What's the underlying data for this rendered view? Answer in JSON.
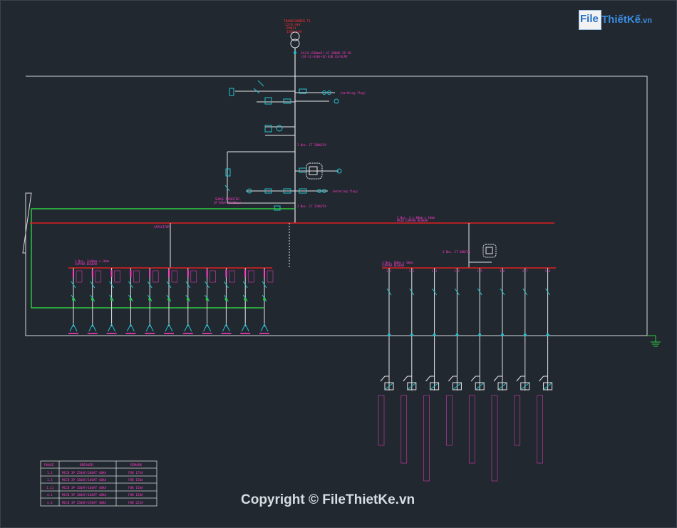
{
  "diagram": {
    "transformer_label": [
      "TRANSFORMER T1",
      "22/0.4kV",
      "DYN11",
      "1500 kVA"
    ],
    "main_cable_label": [
      "3X(1C-630mm2) 4C 2000A 3P 50",
      "(3X-1C-630)+1C-630 CU/XLPE"
    ],
    "earthing_label": "(earthing flag)",
    "metering_label": "(metering flag)",
    "ct_label_1": "3 Nos. CT 2000/5A",
    "ct_label_2": "3 Nos. CT 2500/5A",
    "surge_label": [
      "SURGE ARRESTER",
      "3P 65kA (8/20µs)"
    ],
    "main_bus_label": [
      "3 Nos. 3 x 80mm x 10mm",
      "MAIN COPPER BUSBAR"
    ],
    "capacitor_tag": "CAPACITOR",
    "left_bus_label": [
      "3 Nos. 3x60mm x 10mm",
      "COPPER BUSBAR"
    ],
    "right_bus_label": [
      "3 Nos. 60mm x 10mm",
      "COPPER BUSBAR"
    ],
    "right_ct_label": "3 Nos. CT 800/5A",
    "feeder_tags": [
      "1.1",
      "1.2",
      "1.3",
      "1.4",
      "1.5",
      "1.6",
      "1.7",
      "1.8"
    ]
  },
  "schedule": {
    "headers": [
      "PHASE",
      "BREAKER",
      "REMARK"
    ],
    "rows": [
      [
        "1.1",
        "MCCB 3P 250AF/200AT 40KA",
        "FOR 175A"
      ],
      [
        "1.3",
        "MCCB 3P 160AF/160AT 40KA",
        "FOR 150A"
      ],
      [
        "1.11",
        "MCCB 3P 160AF/160AT 40KA",
        "FOR 150A"
      ],
      [
        "4.1",
        "MCCB 3P 160AF/160AT 40KA",
        "FOR 150A"
      ],
      [
        "4.4",
        "MCCB 3P 250AF/250AT 40KA",
        "FOR 225A"
      ]
    ]
  },
  "branding": {
    "logo_fi": "File",
    "logo_rest": "ThiếtKế",
    "logo_domain": ".vn",
    "copyright": "Copyright © FileThietKe.vn"
  },
  "colors": {
    "background": "#212830",
    "frame": "#d6d6d6",
    "busbar": "#e02020",
    "earth": "#2ecc40",
    "label": "#ff3cc8",
    "symbol": "#22c3d0",
    "transformer_label": "#ff3030"
  }
}
